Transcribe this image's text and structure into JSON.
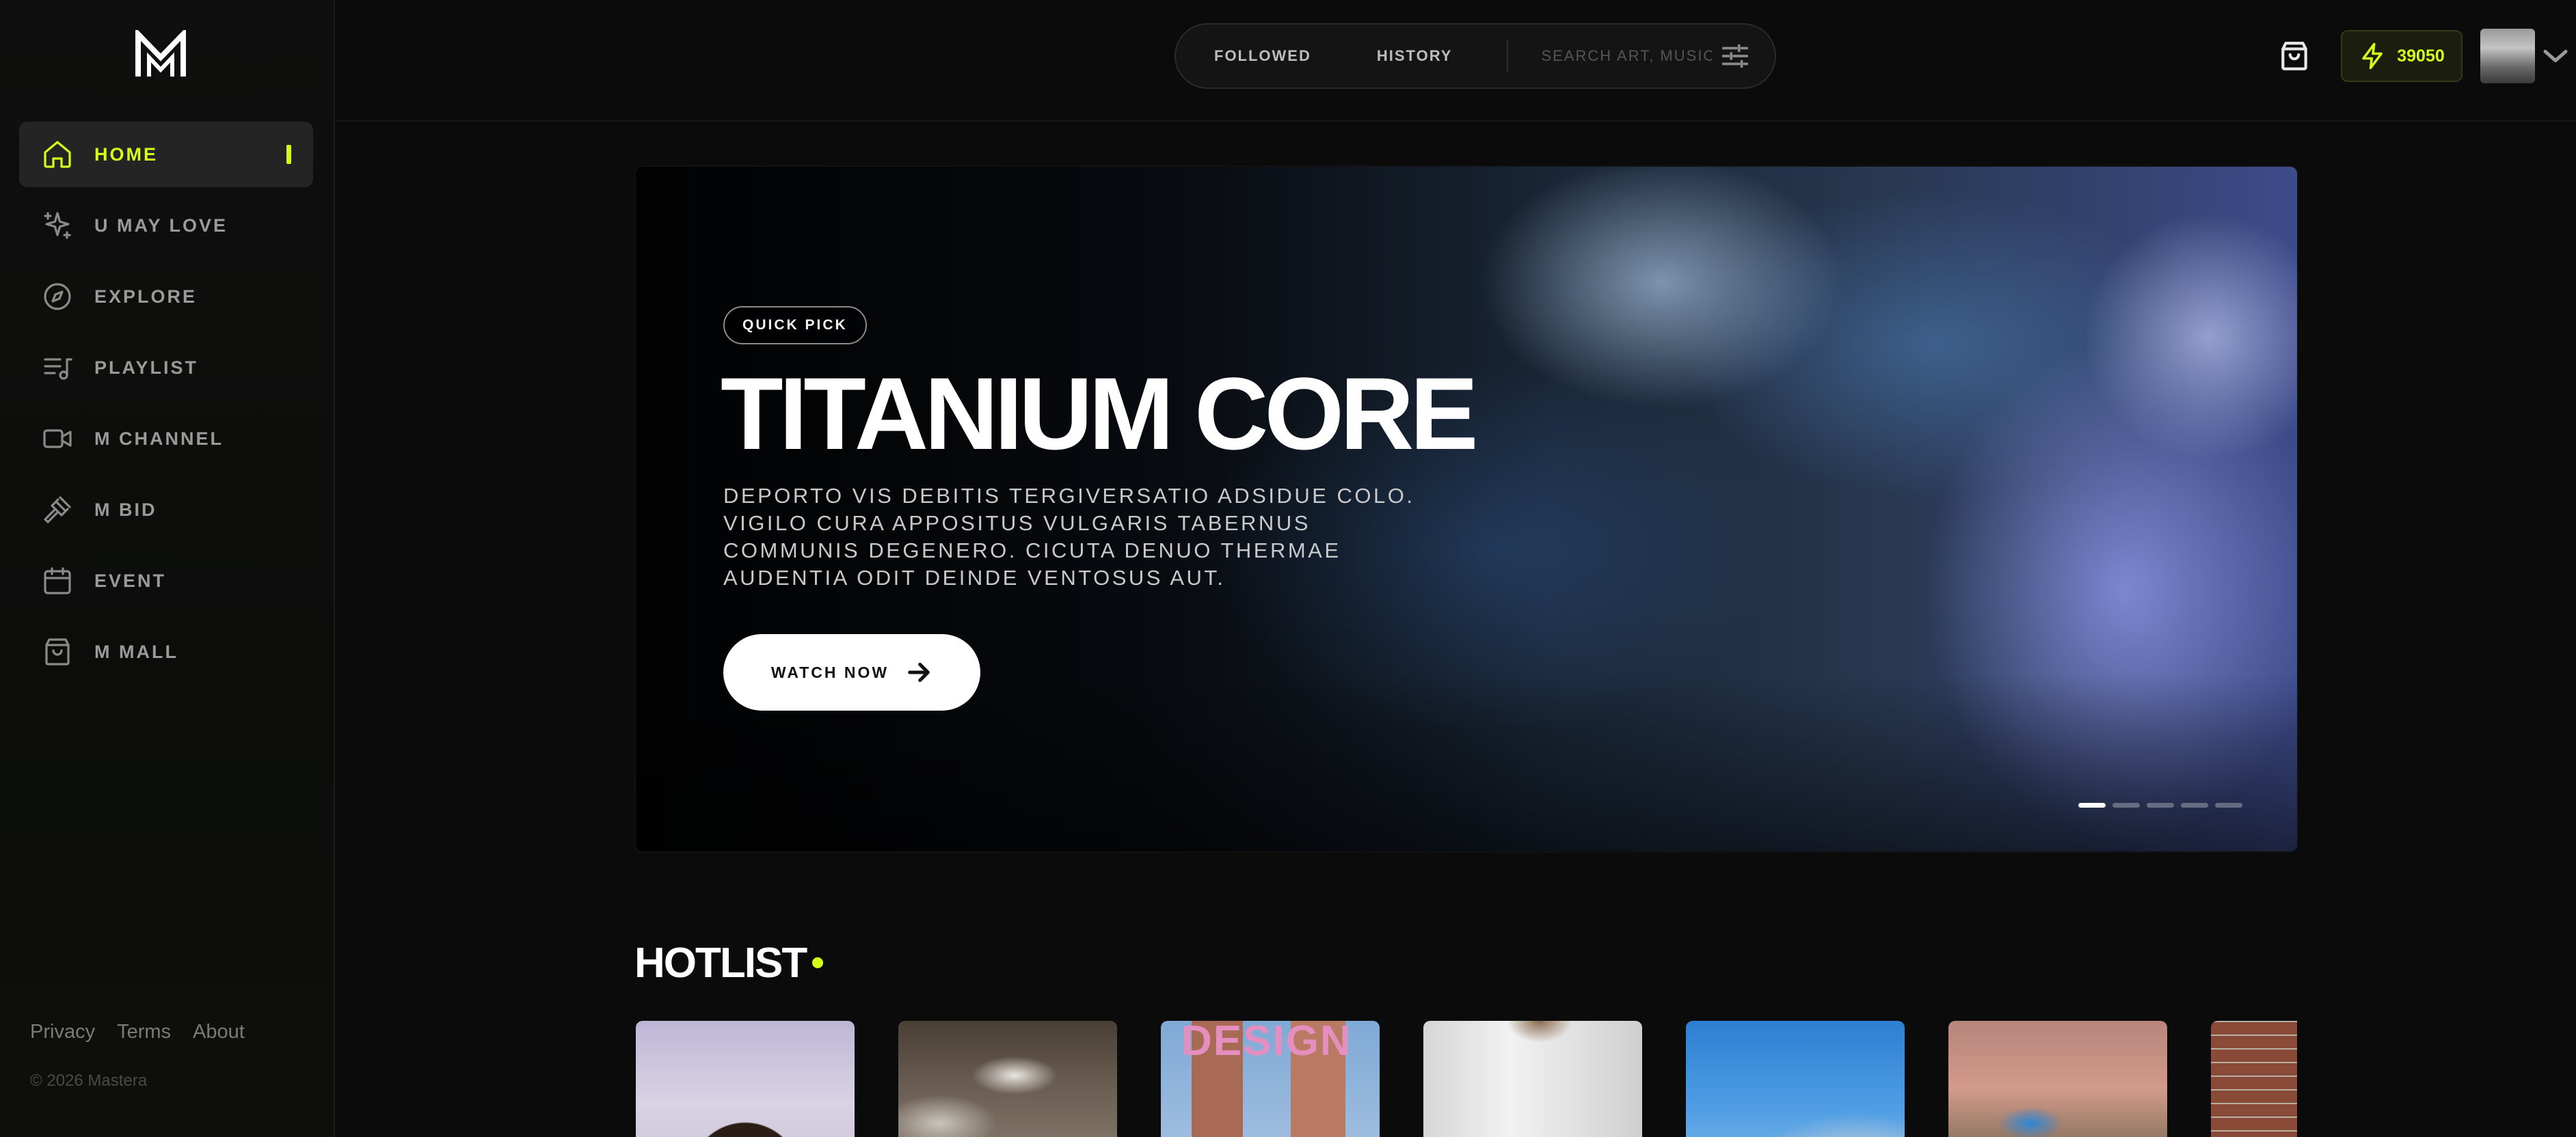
{
  "brand": {
    "logo_text": "M"
  },
  "sidebar": {
    "items": [
      {
        "label": "HOME",
        "icon": "home-icon",
        "active": true
      },
      {
        "label": "U MAY LOVE",
        "icon": "sparkles-icon",
        "active": false
      },
      {
        "label": "EXPLORE",
        "icon": "compass-icon",
        "active": false
      },
      {
        "label": "PLAYLIST",
        "icon": "playlist-icon",
        "active": false
      },
      {
        "label": "M CHANNEL",
        "icon": "video-camera-icon",
        "active": false
      },
      {
        "label": "M BID",
        "icon": "gavel-icon",
        "active": false
      },
      {
        "label": "EVENT",
        "icon": "calendar-icon",
        "active": false
      },
      {
        "label": "M MALL",
        "icon": "shopping-bag-icon",
        "active": false
      }
    ],
    "footer_links": [
      "Privacy",
      "Terms",
      "About"
    ],
    "copyright": "© 2026 Mastera"
  },
  "topbar": {
    "tabs": [
      "FOLLOWED",
      "HISTORY"
    ],
    "search_placeholder": "SEARCH ART, MUSIC",
    "points": "39050"
  },
  "hero": {
    "tag": "QUICK PICK",
    "title": "TITANIUM CORE",
    "description": "DEPORTO VIS DEBITIS TERGIVERSATIO ADSIDUE COLO. VIGILO CURA APPOSITUS VULGARIS TABERNUS COMMUNIS DEGENERO. CICUTA DENUO THERMAE AUDENTIA ODIT DEINDE VENTOSUS AUT.",
    "cta_label": "WATCH NOW",
    "slide_count": 5,
    "active_slide": 1
  },
  "hotlist": {
    "title": "HOTLIST",
    "cards": [
      {
        "thumb": "person-sky"
      },
      {
        "thumb": "sculpture-room"
      },
      {
        "thumb": "design-buildings",
        "overlay_text": "DESIGN"
      },
      {
        "thumb": "white-shirt"
      },
      {
        "thumb": "car-window-sky"
      },
      {
        "thumb": "sunset-street"
      },
      {
        "thumb": "brick-building"
      }
    ]
  },
  "colors": {
    "accent": "#d4ff1a",
    "background": "#0b0b0b"
  }
}
